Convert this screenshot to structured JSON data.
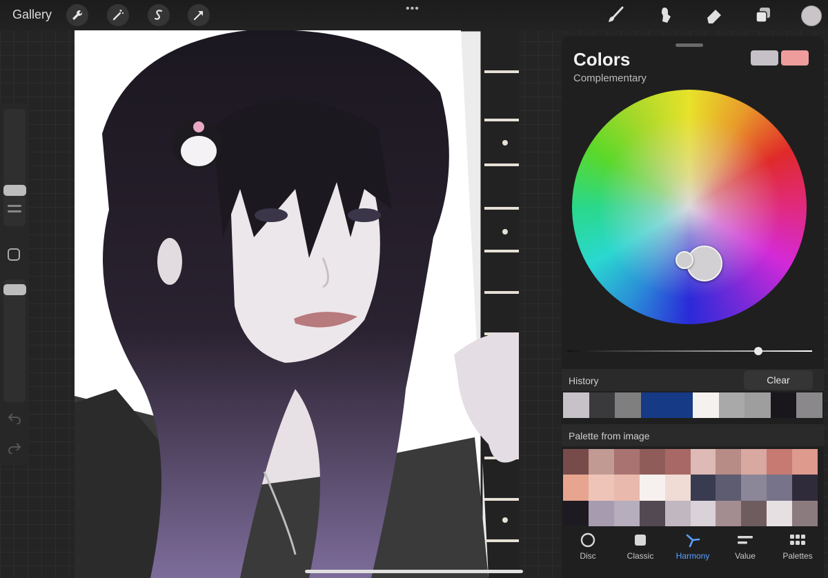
{
  "topbar": {
    "gallery_label": "Gallery",
    "more_dots": "•••"
  },
  "colors_panel": {
    "title": "Colors",
    "subtitle": "Complementary",
    "primary_color": "#c5c1c6",
    "secondary_color": "#ef9c9c",
    "value_slider_level": 0.78,
    "history": {
      "label": "History",
      "clear_label": "Clear",
      "swatches": [
        "#c6c2c7",
        "#3a3a3c",
        "#7f7f80",
        "#163a86",
        "#163a86",
        "#f4f1ee",
        "#a9a9aa",
        "#9e9e9f",
        "#19171c",
        "#8a888b"
      ]
    },
    "palette": {
      "label": "Palette from image",
      "swatches": [
        "#784b4b",
        "#c29a94",
        "#a87371",
        "#8f5c5a",
        "#a86966",
        "#ddbab6",
        "#b78b86",
        "#d9a8a0",
        "#c77a72",
        "#dd9a8d",
        "#e7a590",
        "#efc4b8",
        "#e9b9ad",
        "#f6f1ee",
        "#f0dbd5",
        "#393b50",
        "#5e5c70",
        "#8c8699",
        "#77738a",
        "#302b3b",
        "#1e1a22",
        "#a79caf",
        "#b6adbd",
        "#524953",
        "#c1b7c1",
        "#d9d2d8",
        "#a38d90",
        "#6f5c5f",
        "#e6e0e3",
        "#8c7b7e"
      ]
    },
    "tabs": [
      {
        "label": "Disc",
        "icon": "disc-icon",
        "active": false
      },
      {
        "label": "Classic",
        "icon": "classic-square-icon",
        "active": false
      },
      {
        "label": "Harmony",
        "icon": "harmony-icon",
        "active": true
      },
      {
        "label": "Value",
        "icon": "value-sliders-icon",
        "active": false
      },
      {
        "label": "Palettes",
        "icon": "palettes-grid-icon",
        "active": false
      }
    ]
  },
  "accent_color": "#5aa0ff"
}
